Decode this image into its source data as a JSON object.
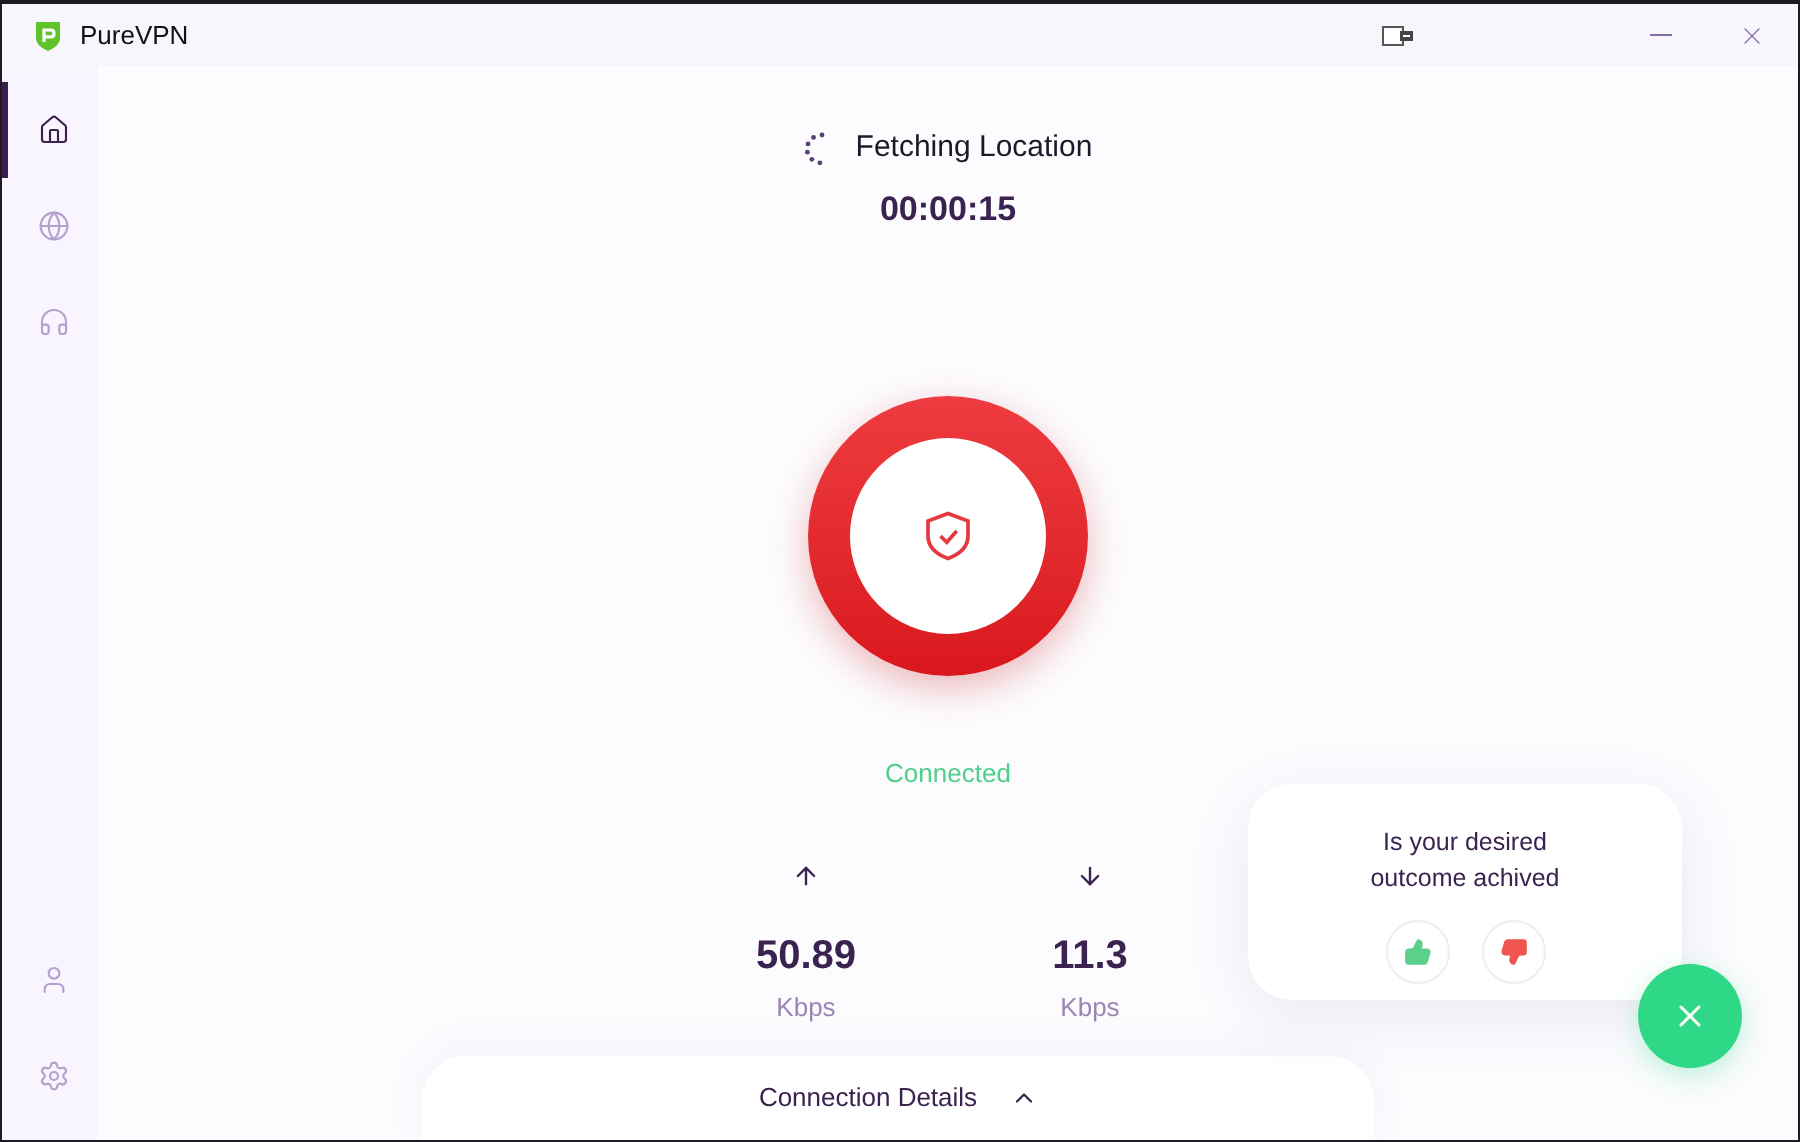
{
  "window": {
    "title": "PureVPN"
  },
  "sidebar": {
    "top_items": [
      {
        "kind": "home",
        "selected": true
      },
      {
        "kind": "globe",
        "selected": false
      },
      {
        "kind": "headset",
        "selected": false
      }
    ],
    "bottom_items": [
      {
        "kind": "user",
        "selected": false
      },
      {
        "kind": "settings",
        "selected": false
      }
    ]
  },
  "status": {
    "loading": true,
    "message": "Fetching Location",
    "timer": "00:00:15",
    "connected": true,
    "state_label": "Connected"
  },
  "speeds": [
    {
      "kind": "upload",
      "value": "50.89",
      "unit": "Kbps"
    },
    {
      "kind": "download",
      "value": "11.3",
      "unit": "Kbps"
    }
  ],
  "connection_details": {
    "label": "Connection Details",
    "expanded": false
  },
  "feedback": {
    "question": "Is your desired outcome achived"
  }
}
